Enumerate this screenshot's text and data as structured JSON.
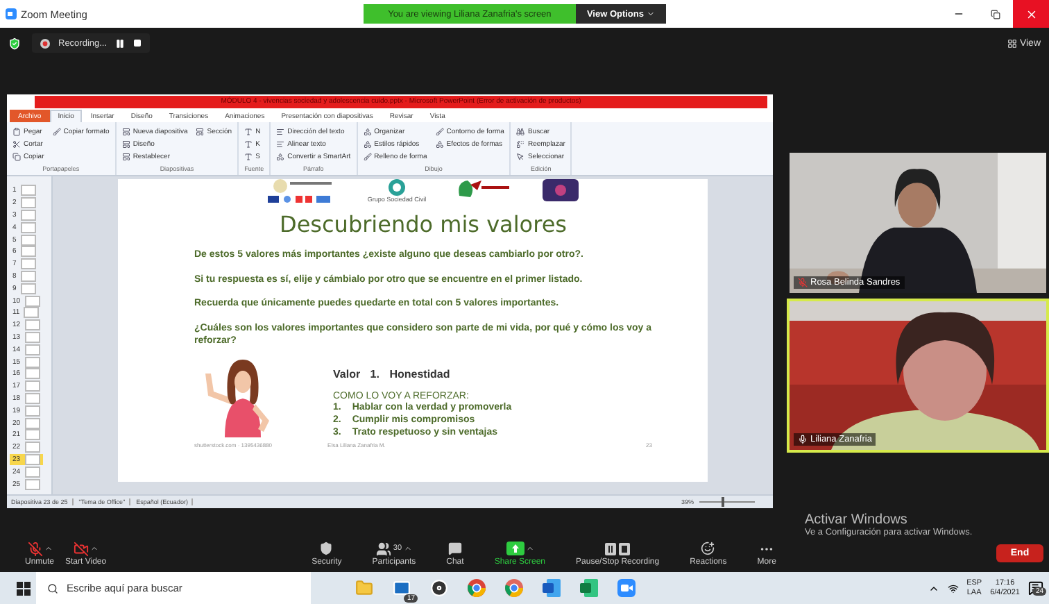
{
  "window": {
    "title": "Zoom Meeting"
  },
  "banner": {
    "text": "You are viewing Liliana Zanafria's screen",
    "button": "View Options"
  },
  "recording": {
    "label": "Recording..."
  },
  "view_button": "View",
  "powerpoint": {
    "title": "MÓDULO 4 - vivencias sociedad y adolescencia cuido.pptx - Microsoft PowerPoint (Error de activación de productos)",
    "tabs": [
      {
        "label": "Archivo",
        "selected": false,
        "kind": "file"
      },
      {
        "label": "Inicio",
        "selected": true,
        "kind": "tab"
      },
      {
        "label": "Insertar",
        "selected": false,
        "kind": "tab"
      },
      {
        "label": "Diseño",
        "selected": false,
        "kind": "tab"
      },
      {
        "label": "Transiciones",
        "selected": false,
        "kind": "tab"
      },
      {
        "label": "Animaciones",
        "selected": false,
        "kind": "tab"
      },
      {
        "label": "Presentación con diapositivas",
        "selected": false,
        "kind": "tab"
      },
      {
        "label": "Revisar",
        "selected": false,
        "kind": "tab"
      },
      {
        "label": "Vista",
        "selected": false,
        "kind": "tab"
      }
    ],
    "groups": [
      {
        "label": "Portapapeles",
        "items": [
          "Pegar",
          "Cortar",
          "Copiar",
          "Copiar formato"
        ]
      },
      {
        "label": "Diapositivas",
        "items": [
          "Nueva diapositiva",
          "Diseño",
          "Restablecer",
          "Sección"
        ]
      },
      {
        "label": "Fuente",
        "items": [
          "N",
          "K",
          "S"
        ]
      },
      {
        "label": "Párrafo",
        "items": [
          "Dirección del texto",
          "Alinear texto",
          "Convertir a SmartArt"
        ]
      },
      {
        "label": "Dibujo",
        "items": [
          "Organizar",
          "Estilos rápidos",
          "Relleno de forma",
          "Contorno de forma",
          "Efectos de formas"
        ]
      },
      {
        "label": "Edición",
        "items": [
          "Buscar",
          "Reemplazar",
          "Seleccionar"
        ]
      }
    ],
    "thumbnails": [
      {
        "number": "1",
        "selected": false
      },
      {
        "number": "2",
        "selected": false
      },
      {
        "number": "3",
        "selected": false
      },
      {
        "number": "4",
        "selected": false
      },
      {
        "number": "5",
        "selected": false
      },
      {
        "number": "6",
        "selected": false
      },
      {
        "number": "7",
        "selected": false
      },
      {
        "number": "8",
        "selected": false
      },
      {
        "number": "9",
        "selected": false
      },
      {
        "number": "10",
        "selected": false
      },
      {
        "number": "11",
        "selected": false
      },
      {
        "number": "12",
        "selected": false
      },
      {
        "number": "13",
        "selected": false
      },
      {
        "number": "14",
        "selected": false
      },
      {
        "number": "15",
        "selected": false
      },
      {
        "number": "16",
        "selected": false
      },
      {
        "number": "17",
        "selected": false
      },
      {
        "number": "18",
        "selected": false
      },
      {
        "number": "19",
        "selected": false
      },
      {
        "number": "20",
        "selected": false
      },
      {
        "number": "21",
        "selected": false
      },
      {
        "number": "22",
        "selected": false
      },
      {
        "number": "23",
        "selected": true
      },
      {
        "number": "24",
        "selected": false
      },
      {
        "number": "25",
        "selected": false
      }
    ],
    "slide": {
      "logo_caption": "Grupo Sociedad Civil",
      "title": "Descubriendo mis valores",
      "paragraphs": [
        "De estos 5 valores más importantes ¿existe alguno que deseas cambiarlo por otro?.",
        "Si tu respuesta es sí, elije y cámbialo por otro que se encuentre en el primer listado.",
        "Recuerda que únicamente puedes quedarte en total con 5 valores importantes.",
        "¿Cuáles son los valores importantes que considero son parte de mi vida, por qué y cómo los voy a reforzar?"
      ],
      "value_number": "Valor 1.",
      "value_name": "Honestidad",
      "list_heading": "COMO LO VOY A REFORZAR:",
      "list": [
        {
          "marker": "1.",
          "text": "Hablar con la verdad y promoverla"
        },
        {
          "marker": "2.",
          "text": "Cumplir mis compromisos"
        },
        {
          "marker": "3.",
          "text": "Trato respetuoso y sin ventajas"
        }
      ],
      "credit": "shutterstock.com · 1395436880",
      "footer": "Elsa Liliana Zanafria M.",
      "page": "23"
    },
    "status": [
      "Diapositiva 23 de 25",
      "\"Tema de Office\"",
      "Español (Ecuador)"
    ],
    "zoom": "39%",
    "zoom_slider": {
      "level": 0.4
    }
  },
  "participants": [
    {
      "name": "Rosa Belinda Sandres",
      "muted": true,
      "active_speaker": false,
      "kind": "wall"
    },
    {
      "name": "Liliana Zanafria",
      "muted": false,
      "active_speaker": true,
      "kind": "couch"
    }
  ],
  "toolbar": [
    {
      "label": "Unmute",
      "kind": "mic",
      "caret": true
    },
    {
      "label": "Start Video",
      "kind": "video",
      "caret": true
    },
    {
      "label": "Security",
      "kind": "security",
      "caret": false
    },
    {
      "label": "Participants",
      "kind": "participants",
      "count": "30",
      "caret": true
    },
    {
      "label": "Chat",
      "kind": "chat",
      "caret": false
    },
    {
      "label": "Share Screen",
      "kind": "share",
      "caret": true
    },
    {
      "label": "Pause/Stop Recording",
      "kind": "recording",
      "caret": false
    },
    {
      "label": "Reactions",
      "kind": "reactions",
      "caret": false
    },
    {
      "label": "More",
      "kind": "more",
      "caret": false
    }
  ],
  "end_button": "End",
  "activation": {
    "title": "Activar Windows",
    "subtitle": "Ve a Configuración para activar Windows."
  },
  "taskbar": {
    "search_placeholder": "Escribe aquí para buscar",
    "apps": [
      {
        "kind": "explorer"
      },
      {
        "kind": "mail",
        "badge": "17"
      },
      {
        "kind": "media"
      },
      {
        "kind": "chrome"
      },
      {
        "kind": "chrome-alt"
      },
      {
        "kind": "word"
      },
      {
        "kind": "excel"
      },
      {
        "kind": "zoom"
      }
    ],
    "language": [
      "ESP",
      "LAA"
    ],
    "time": "17:16",
    "date": "6/4/2021",
    "notifications": "24"
  }
}
